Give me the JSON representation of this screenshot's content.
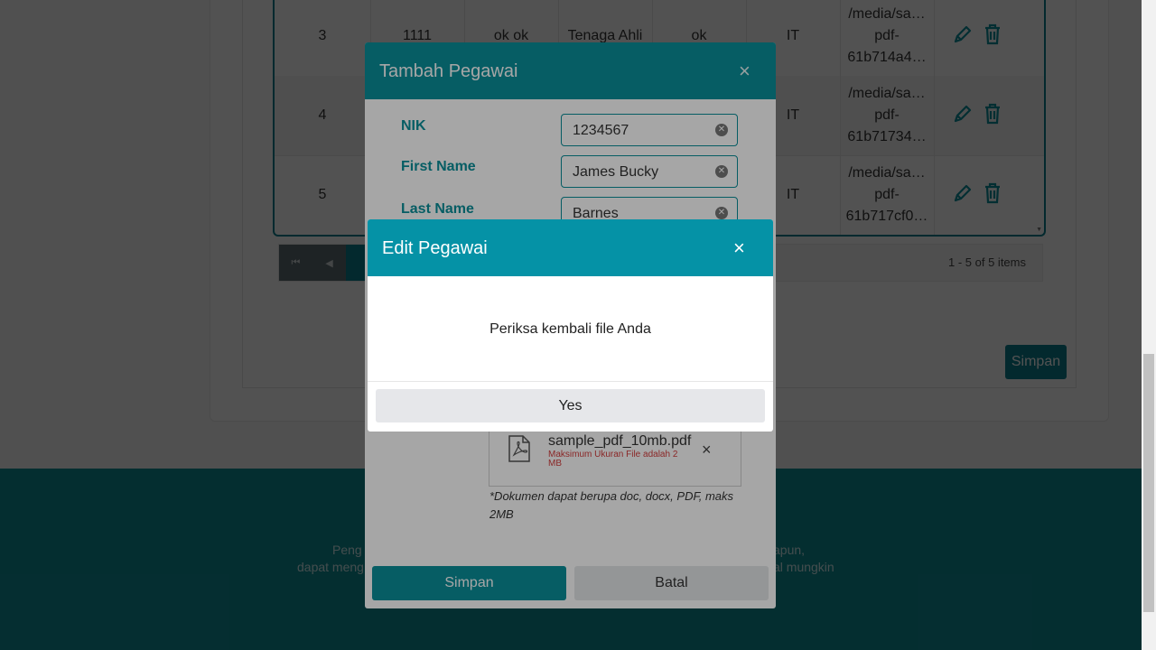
{
  "grid": {
    "rows": [
      {
        "no": "3",
        "nik": "1111",
        "name": "ok ok",
        "role": "Tenaga Ahli",
        "status": "ok",
        "dept": "IT",
        "file": [
          "/media/sa…",
          "pdf-",
          "61b714a4…"
        ]
      },
      {
        "no": "4",
        "nik": "",
        "name": "",
        "role": "",
        "status": "",
        "dept": "IT",
        "file": [
          "/media/sa…",
          "pdf-",
          "61b71734…"
        ]
      },
      {
        "no": "5",
        "nik": "",
        "name": "",
        "role": "",
        "status": "",
        "dept": "IT",
        "file": [
          "/media/sa…",
          "pdf-",
          "61b717cf0…"
        ]
      }
    ]
  },
  "pager": {
    "info": "1 - 5 of 5 items",
    "first_icon": "first-page-icon",
    "prev_icon": "prev-page-icon"
  },
  "background": {
    "save_label": "Simpan"
  },
  "footer": {
    "line1_left": "Peng",
    "line2_left": "dapat meng",
    "line1_right": "apun,",
    "line2_right": "al mungkin"
  },
  "add_modal": {
    "title": "Tambah Pegawai",
    "close": "×",
    "fields": [
      {
        "label": "NIK",
        "value": "1234567"
      },
      {
        "label": "First Name",
        "value": "James Bucky"
      },
      {
        "label": "Last Name",
        "value": "Barnes"
      }
    ],
    "file": {
      "name": "sample_pdf_10mb.pdf",
      "error": "Maksimum Ukuran File adalah 2 MB",
      "remove": "×"
    },
    "note": "*Dokumen dapat berupa doc, docx, PDF, maks 2MB",
    "save_label": "Simpan",
    "cancel_label": "Batal"
  },
  "edit_modal": {
    "title": "Edit Pegawai",
    "close": "×",
    "message": "Periksa kembali file Anda",
    "yes_label": "Yes"
  },
  "colors": {
    "teal": "#0a8f9a",
    "teal_header": "#0592a6",
    "footer": "#0f8f96",
    "error": "#d43c3c"
  }
}
